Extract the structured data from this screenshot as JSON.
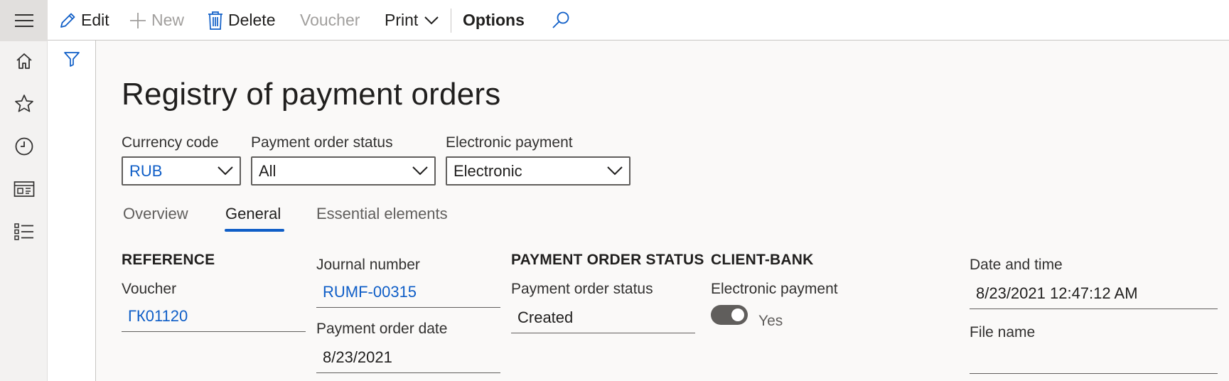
{
  "commandbar": {
    "edit_label": "Edit",
    "new_label": "New",
    "delete_label": "Delete",
    "voucher_label": "Voucher",
    "print_label": "Print",
    "options_label": "Options"
  },
  "navrail": {
    "icons": [
      "hamburger-icon",
      "home-icon",
      "star-icon",
      "clock-icon",
      "workspace-icon",
      "list-icon"
    ]
  },
  "page": {
    "title": "Registry of payment orders"
  },
  "filters": {
    "currency_label": "Currency code",
    "currency_value": "RUB",
    "status_label": "Payment order status",
    "status_value": "All",
    "electronic_label": "Electronic payment",
    "electronic_value": "Electronic"
  },
  "tabs": [
    {
      "label": "Overview",
      "active": false
    },
    {
      "label": "General",
      "active": true
    },
    {
      "label": "Essential elements",
      "active": false
    }
  ],
  "general": {
    "reference_heading": "REFERENCE",
    "voucher_label": "Voucher",
    "voucher_value": "ГК01120",
    "journal_label": "Journal number",
    "journal_value": "RUMF-00315",
    "po_date_label": "Payment order date",
    "po_date_value": "8/23/2021",
    "status_heading": "PAYMENT ORDER STATUS",
    "status_label": "Payment order status",
    "status_value": "Created",
    "client_bank_heading": "CLIENT-BANK",
    "electronic_label": "Electronic payment",
    "electronic_value": "Yes",
    "electronic_on": true,
    "datetime_label": "Date and time",
    "datetime_value": "8/23/2021 12:47:12 AM",
    "filename_label": "File name",
    "filename_value": ""
  },
  "colors": {
    "accent": "#0f5ec7",
    "nav_bg": "#f3f2f1",
    "page_bg": "#faf9f8"
  }
}
